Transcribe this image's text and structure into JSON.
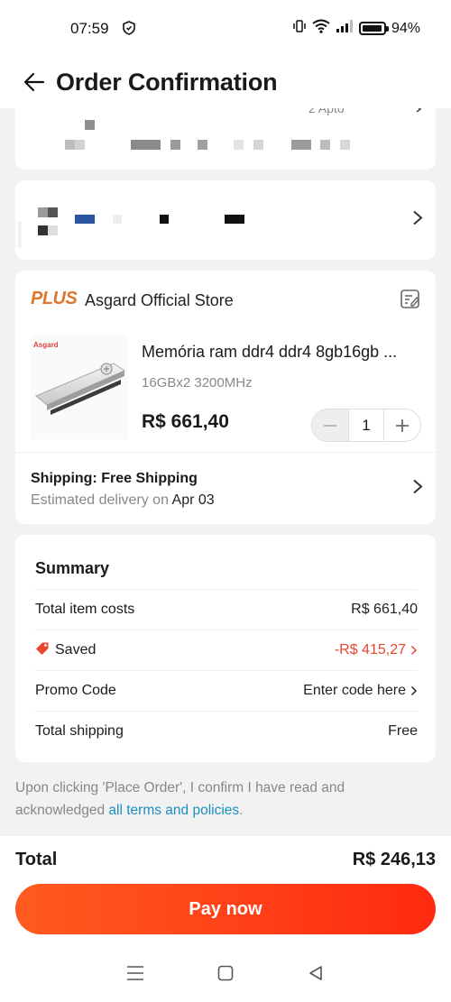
{
  "status_bar": {
    "time": "07:59",
    "battery": "94%",
    "battery_level": 0.94,
    "icons": [
      "shield-icon",
      "vibrate-icon",
      "wifi-icon",
      "signal-icon",
      "battery-icon"
    ]
  },
  "header": {
    "title": "Order Confirmation",
    "back_icon": "arrow-left-icon"
  },
  "address_card": {
    "partial_text": "2 Apto"
  },
  "store": {
    "badge": "PLUS",
    "name": "Asgard Official Store",
    "note_icon": "edit-note-icon"
  },
  "product": {
    "brand": "Asgard",
    "title": "Memória ram ddr4 ddr4 8gb16gb ...",
    "variant": "16GBx2 3200MHz",
    "price": "R$ 661,40",
    "quantity": "1"
  },
  "shipping": {
    "title": "Shipping: Free Shipping",
    "estimate_prefix": "Estimated delivery on ",
    "estimate_date": "Apr 03"
  },
  "summary": {
    "title": "Summary",
    "rows": [
      {
        "label": "Total item costs",
        "value": "R$ 661,40"
      },
      {
        "label": "Saved",
        "value": "-R$ 415,27"
      },
      {
        "label": "Promo Code",
        "value": "Enter code here"
      },
      {
        "label": "Total shipping",
        "value": "Free"
      }
    ]
  },
  "terms": {
    "text_prefix": "Upon clicking 'Place Order', I confirm I have read and acknowledged ",
    "link": "all terms and policies",
    "text_suffix": "."
  },
  "footer": {
    "total_label": "Total",
    "total_value": "R$ 246,13",
    "pay_button": "Pay now"
  },
  "colors": {
    "accent": "#ff3b14",
    "saved": "#e8462d",
    "link": "#1b8fc0",
    "plus": "#e0762e"
  }
}
